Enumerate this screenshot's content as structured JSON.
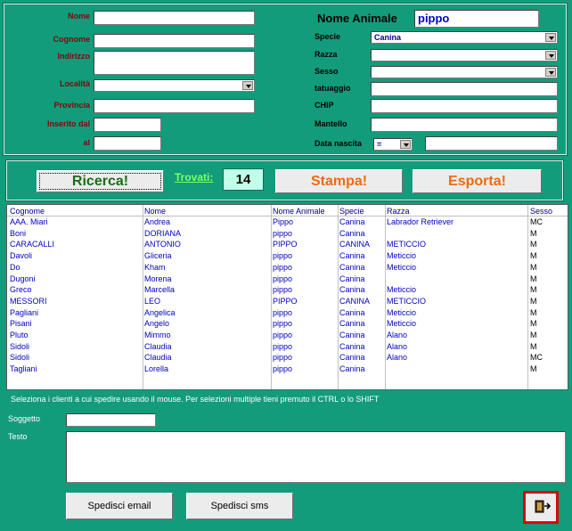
{
  "form": {
    "nome_label": "Nome",
    "cognome_label": "Cognome",
    "indirizzo_label": "Indirizzo",
    "localita_label": "Località",
    "provincia_label": "Provincia",
    "inserito_dal_label": "Inserito dal",
    "al_label": "al",
    "nome_animale_label": "Nome Animale",
    "nome_animale_value": "pippo",
    "specie_label": "Specie",
    "specie_value": "Canina",
    "razza_label": "Razza",
    "sesso_label": "Sesso",
    "tatuaggio_label": "tatuaggio",
    "chip_label": "CHIP",
    "mantello_label": "Mantello",
    "data_nascita_label": "Data nascita",
    "data_op_value": "="
  },
  "actions": {
    "ricerca_label": "Ricerca!",
    "trovati_label": "Trovati:",
    "trovati_count": "14",
    "stampa_label": "Stampa!",
    "esporta_label": "Esporta!"
  },
  "table": {
    "headers": [
      "Cognome",
      "Nome",
      "Nome Animale",
      "Specie",
      "Razza",
      "Sesso"
    ],
    "rows": [
      [
        "AAA. Miari",
        "Andrea",
        "Pippo",
        "Canina",
        "Labrador Retriever",
        "MC"
      ],
      [
        "Boni",
        "DORIANA",
        "pippo",
        "Canina",
        "",
        "M"
      ],
      [
        "CARACALLI",
        "ANTONIO",
        "PIPPO",
        "CANINA",
        " METICCIO",
        "M"
      ],
      [
        "Davoli",
        "Gliceria",
        "pippo",
        "Canina",
        "Meticcio",
        "M"
      ],
      [
        "Do",
        "Kham",
        "pippo",
        "Canina",
        "Meticcio",
        "M"
      ],
      [
        "Dugoni",
        "Morena",
        "pippo",
        "Canina",
        "",
        "M"
      ],
      [
        "Greco",
        "Marcella",
        "pippo",
        "Canina",
        "Meticcio",
        "M"
      ],
      [
        "MESSORI",
        "LEO",
        "PIPPO",
        "CANINA",
        " METICCIO",
        "M"
      ],
      [
        "Pagliani",
        "Angelica",
        "pippo",
        "Canina",
        "Meticcio",
        "M"
      ],
      [
        "Pisani",
        "Angelo",
        "pippo",
        "Canina",
        "Meticcio",
        "M"
      ],
      [
        "Pluto",
        "Mimmo",
        "pippo",
        "Canina",
        "Alano",
        "M"
      ],
      [
        "Sidoli",
        "Claudia",
        "pippo",
        "Canina",
        "Alano",
        "M"
      ],
      [
        "Sidoli",
        "Claudia",
        "pippo",
        "Canina",
        "Alano",
        "MC"
      ],
      [
        "Tagliani",
        "Lorella",
        "pippo",
        "Canina",
        "",
        "M"
      ]
    ]
  },
  "hint": "Seleziona i clienti a cui spedire usando il mouse. Per selezioni multiple tieni premuto il CTRL o lo SHIFT",
  "mail": {
    "soggetto_label": "Soggetto",
    "testo_label": "Testo",
    "email_button": "Spedisci email",
    "sms_button": "Spedisci sms"
  },
  "icons": {
    "exit": "exit-door-icon"
  },
  "colors": {
    "background": "#129c7b",
    "exit_border": "#e00000",
    "ricerca_text": "#1a6e1a",
    "orange_text": "#f06a10"
  }
}
